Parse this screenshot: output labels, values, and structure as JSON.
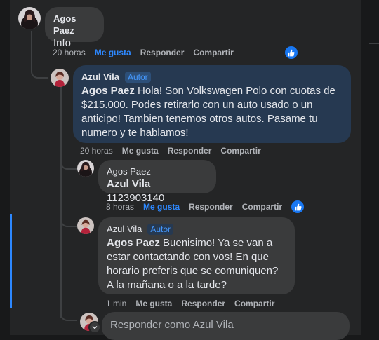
{
  "comments": [
    {
      "author": "Agos Paez",
      "text": "Info",
      "time": "20 horas",
      "like_label": "Me gusta",
      "reply_label": "Responder",
      "share_label": "Compartir",
      "liked": true
    },
    {
      "author": "Azul Vila",
      "badge": "Autor",
      "mention": "Agos Paez",
      "text": " Hola! Son Volkswagen Polo con cuotas de $215.000. Podes retirarlo con un auto usado o un anticipo! Tambien tenemos otros autos. Pasame tu numero y te hablamos!",
      "time": "20 horas",
      "like_label": "Me gusta",
      "reply_label": "Responder",
      "share_label": "Compartir",
      "liked": false
    },
    {
      "author": "Agos Paez",
      "mention": "Azul Vila",
      "text": " 1123903140",
      "time": "8 horas",
      "like_label": "Me gusta",
      "reply_label": "Responder",
      "share_label": "Compartir",
      "liked": true
    },
    {
      "author": "Azul Vila",
      "badge": "Autor",
      "mention": "Agos Paez",
      "text": " Buenisimo! Ya se van a estar contactando con vos! En que horario preferis que se comuniquen? A la mañana o a la tarde?",
      "time": "1 min",
      "like_label": "Me gusta",
      "reply_label": "Responder",
      "share_label": "Compartir",
      "liked": false
    }
  ],
  "reply_box": {
    "placeholder": "Responder como Azul Vila"
  },
  "icons": {
    "like": "thumbs-up-icon",
    "switch_profile": "chevron-down-icon"
  },
  "colors": {
    "accent": "#2d88ff",
    "author_bubble": "#263951",
    "bubble": "#3a3b3c",
    "background": "#242526"
  }
}
